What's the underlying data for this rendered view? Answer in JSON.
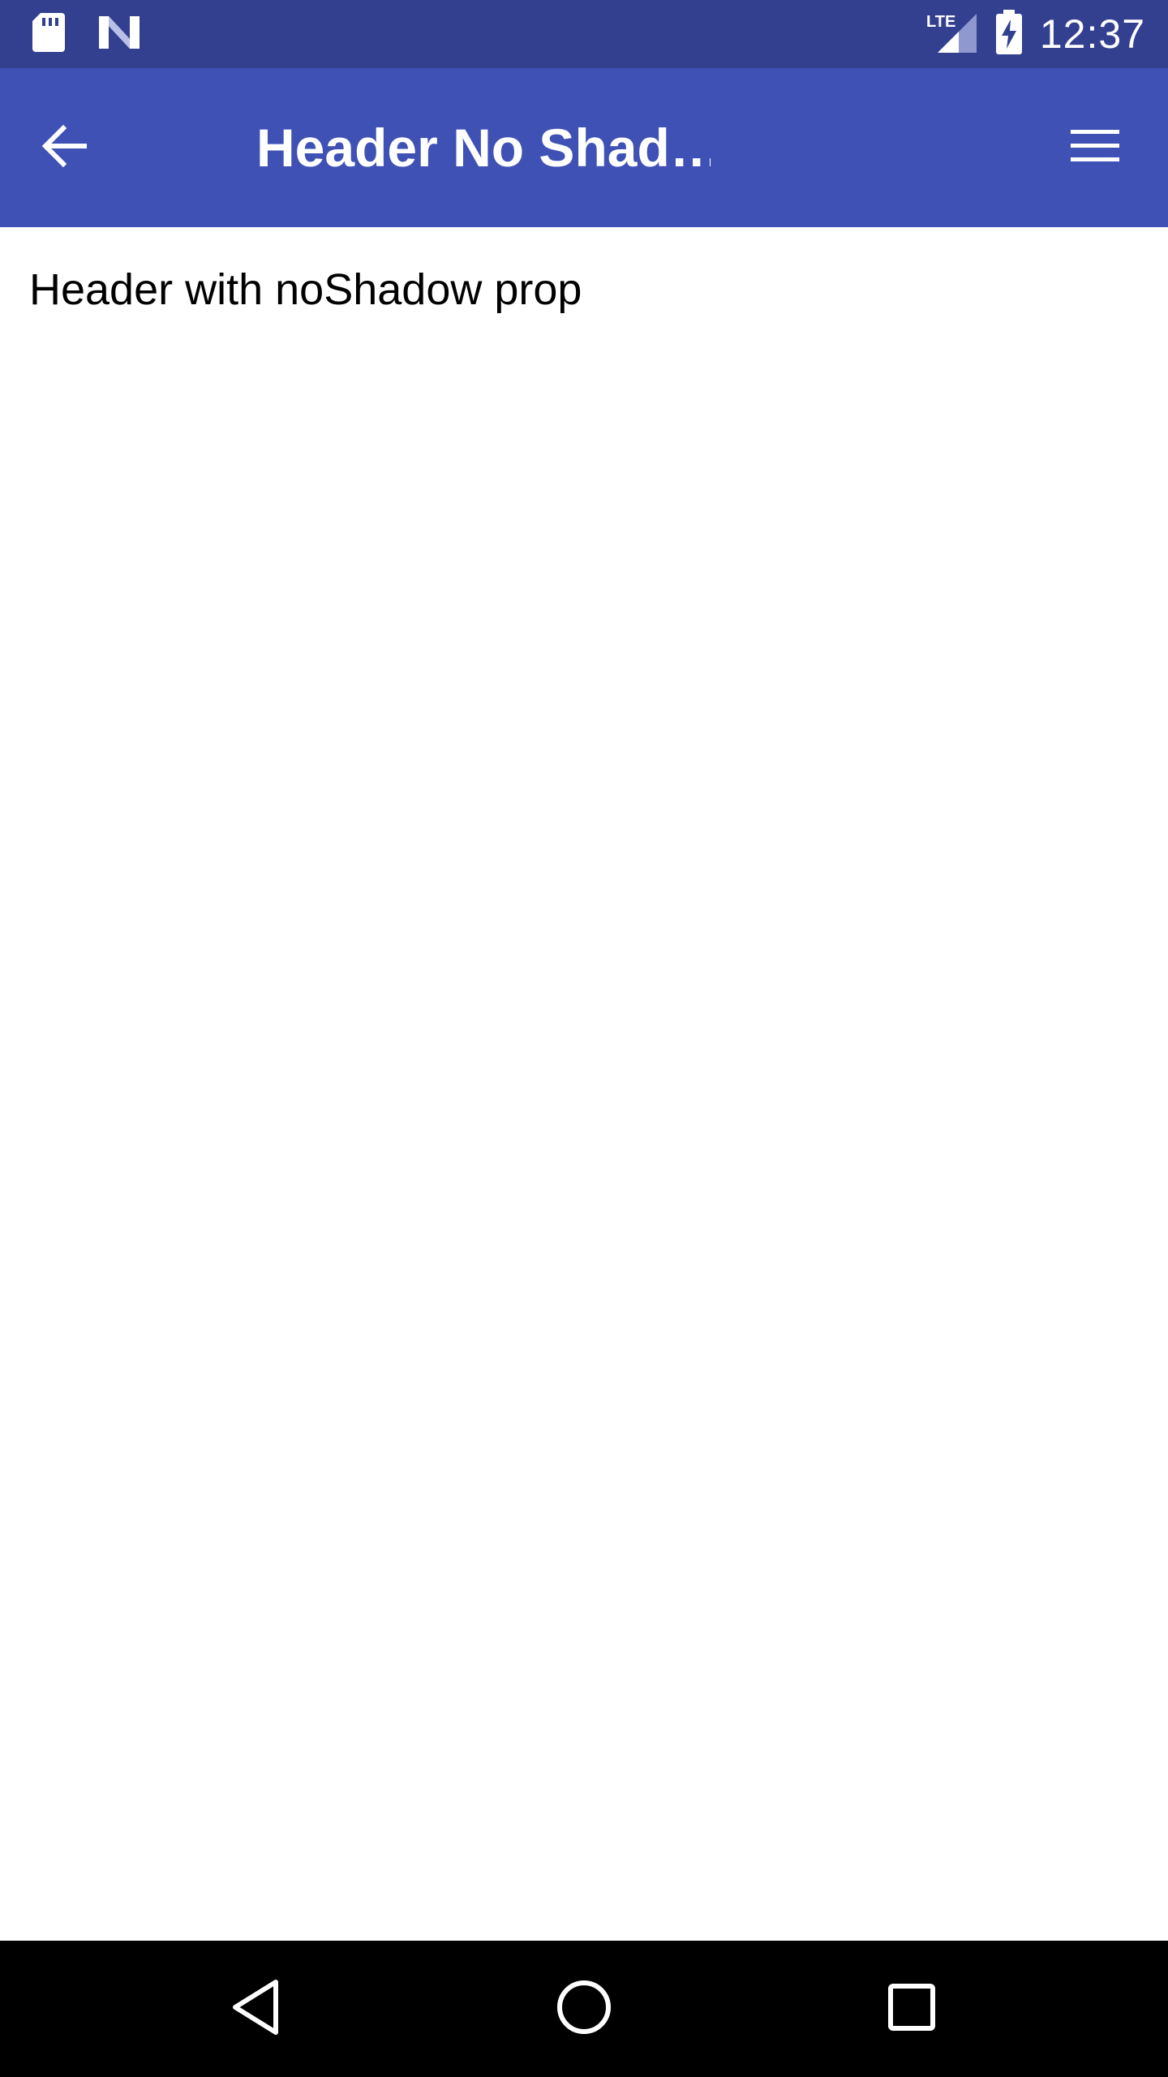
{
  "status_bar": {
    "time": "12:37",
    "network": "LTE",
    "icons": [
      "sd-card-icon",
      "notification-n-icon",
      "lte-signal-icon",
      "battery-charging-icon"
    ],
    "background": "#33408f"
  },
  "header": {
    "title": "Header No Shad…",
    "back_icon": "arrow-back-icon",
    "menu_icon": "hamburger-menu-icon",
    "background": "#3f51b5"
  },
  "content": {
    "text": "Header with noShadow prop"
  },
  "nav_bar": {
    "items": [
      "back-triangle-icon",
      "home-circle-icon",
      "recents-square-icon"
    ],
    "background": "#000000"
  }
}
